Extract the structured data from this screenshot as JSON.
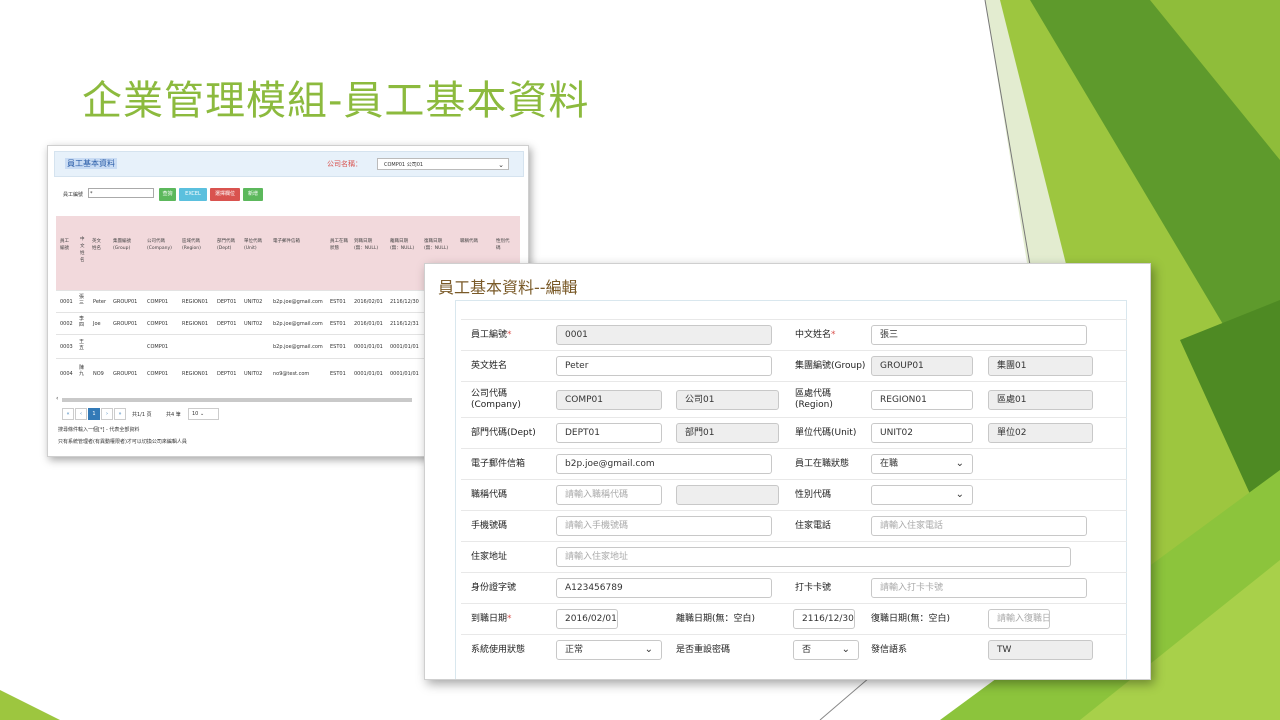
{
  "slide": {
    "title": "企業管理模組-員工基本資料"
  },
  "colors": {
    "green_light": "#9dc63f",
    "green_dark": "#4e8a23",
    "title_green": "#8cba3e"
  },
  "list": {
    "title": "員工基本資料",
    "company_label": "公司名稱：",
    "company_value": "COMP01 公司01",
    "filter_label": "員工編號",
    "filter_value": "*",
    "buttons": [
      "查詢",
      "EXCEL",
      "選擇欄位",
      "新增"
    ],
    "columns": [
      "員工編號",
      "中文姓名",
      "英文姓名",
      "集團編號(Group)",
      "公司代碼(Company)",
      "區域代碼(Region)",
      "部門代碼(Dept)",
      "單位代碼(Unit)",
      "電子郵件信箱",
      "員工在職狀態",
      "到職日期(無：NULL)",
      "離職日期(無：NULL)",
      "復職日期(無：NULL)",
      "職稱代碼",
      "性別代碼"
    ],
    "rows": [
      [
        "0001",
        "張三",
        "Peter",
        "GROUP01",
        "COMP01",
        "REGION01",
        "DEPT01",
        "UNIT02",
        "b2p.joe@gmail.com",
        "EST01",
        "2016/02/01",
        "2116/12/30"
      ],
      [
        "0002",
        "李四",
        "Joe",
        "GROUP01",
        "COMP01",
        "REGION01",
        "DEPT01",
        "UNIT02",
        "b2p.joe@gmail.com",
        "EST01",
        "2016/01/01",
        "2116/12/31"
      ],
      [
        "0003",
        "王五",
        "",
        "",
        "COMP01",
        "",
        "",
        "",
        "b2p.joe@gmail.com",
        "EST01",
        "0001/01/01",
        "0001/01/01"
      ],
      [
        "0004",
        "陳九",
        "NO9",
        "GROUP01",
        "COMP01",
        "REGION01",
        "DEPT01",
        "UNIT02",
        "no9@test.com",
        "EST01",
        "0001/01/01",
        "0001/01/01"
      ]
    ],
    "pager": {
      "first": "«",
      "prev": "‹",
      "current": "1",
      "next": "›",
      "last": "»",
      "page_info": "共1/1 頁",
      "count_label": "共4 筆",
      "page_size": "10"
    },
    "notes": [
      "搜尋條件輸入一個[*] - 代表全部資料",
      "只有系統管理者(有異動權限者)才可以切換公司來編輯人員"
    ]
  },
  "form": {
    "title": "員工基本資料--編輯",
    "emp_no_label": "員工編號",
    "emp_no": "0001",
    "cname_label": "中文姓名",
    "cname": "張三",
    "ename_label": "英文姓名",
    "ename": "Peter",
    "group_label": "集團編號(Group)",
    "group_code": "GROUP01",
    "group_name": "集團01",
    "company_label": "公司代碼\n(Company)",
    "company_code": "COMP01",
    "company_name": "公司01",
    "region_label": "區處代碼\n(Region)",
    "region_code": "REGION01",
    "region_name": "區處01",
    "dept_label": "部門代碼(Dept)",
    "dept_code": "DEPT01",
    "dept_name": "部門01",
    "unit_label": "單位代碼(Unit)",
    "unit_code": "UNIT02",
    "unit_name": "單位02",
    "email_label": "電子郵件信箱",
    "email": "b2p.joe@gmail.com",
    "status_label": "員工在職狀態",
    "status": "在職",
    "jobtitle_label": "職稱代碼",
    "jobtitle_placeholder": "請輸入職稱代碼",
    "gender_label": "性別代碼",
    "gender": "",
    "mobile_label": "手機號碼",
    "mobile_placeholder": "請輸入手機號碼",
    "homephone_label": "住家電話",
    "homephone_placeholder": "請輸入住家電話",
    "address_label": "住家地址",
    "address_placeholder": "請輸入住家地址",
    "idno_label": "身份證字號",
    "idno": "A123456789",
    "card_label": "打卡卡號",
    "card_placeholder": "請輸入打卡卡號",
    "hire_label": "到職日期",
    "hire_date": "2016/02/01",
    "leave_label": "離職日期(無：空白)",
    "leave_date": "2116/12/30",
    "rehire_label": "復職日期(無：空白)",
    "rehire_placeholder": "請輸入復職日",
    "sys_status_label": "系統使用狀態",
    "sys_status": "正常",
    "reset_pw_label": "是否重設密碼",
    "reset_pw": "否",
    "lang_label": "發信語系",
    "lang": "TW"
  }
}
